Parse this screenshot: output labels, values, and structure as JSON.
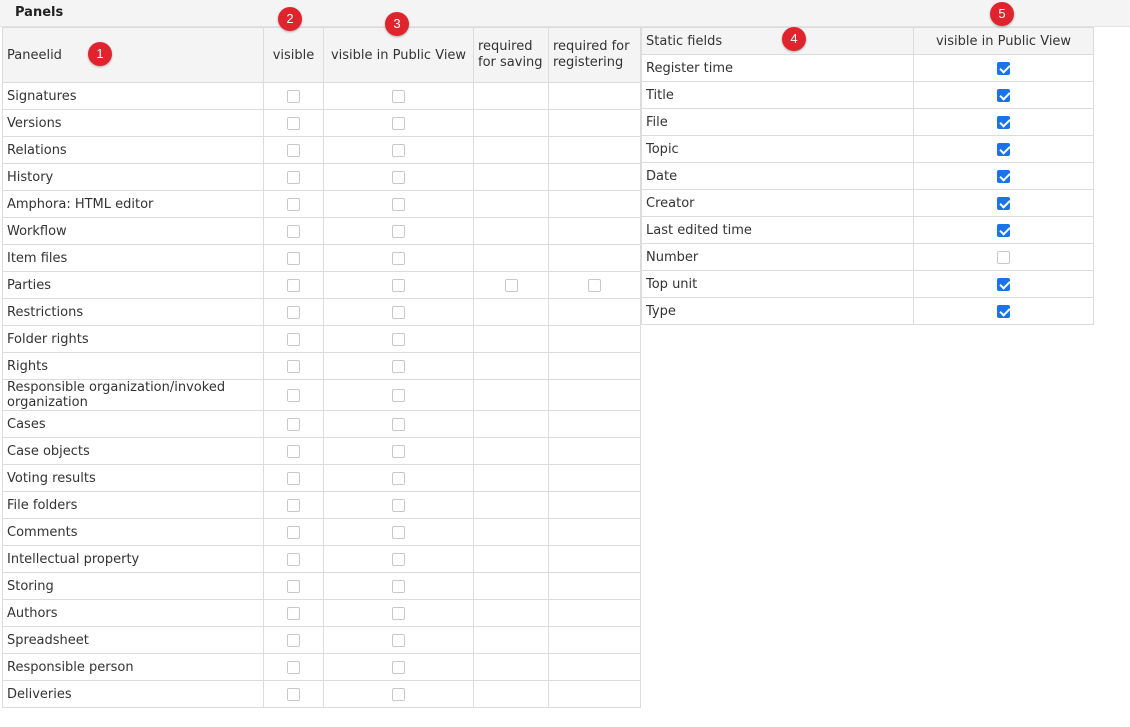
{
  "header": {
    "title": "Panels"
  },
  "panels_table": {
    "columns": [
      "Paneelid",
      "visible",
      "visible in Public View",
      "required for saving",
      "required for registering"
    ],
    "rows": [
      {
        "name": "Signatures",
        "visible": false,
        "public": false
      },
      {
        "name": "Versions",
        "visible": false,
        "public": false
      },
      {
        "name": "Relations",
        "visible": false,
        "public": false
      },
      {
        "name": "History",
        "visible": false,
        "public": false
      },
      {
        "name": "Amphora: HTML editor",
        "visible": false,
        "public": false
      },
      {
        "name": "Workflow",
        "visible": false,
        "public": false
      },
      {
        "name": "Item files",
        "visible": false,
        "public": false
      },
      {
        "name": "Parties",
        "visible": false,
        "public": false,
        "required_saving": false,
        "required_registering": false
      },
      {
        "name": "Restrictions",
        "visible": false,
        "public": false
      },
      {
        "name": "Folder rights",
        "visible": false,
        "public": false
      },
      {
        "name": "Rights",
        "visible": false,
        "public": false
      },
      {
        "name": "Responsible organization/invoked organization",
        "visible": false,
        "public": false
      },
      {
        "name": "Cases",
        "visible": false,
        "public": false
      },
      {
        "name": "Case objects",
        "visible": false,
        "public": false
      },
      {
        "name": "Voting results",
        "visible": false,
        "public": false
      },
      {
        "name": "File folders",
        "visible": false,
        "public": false
      },
      {
        "name": "Comments",
        "visible": false,
        "public": false
      },
      {
        "name": "Intellectual property",
        "visible": false,
        "public": false
      },
      {
        "name": "Storing",
        "visible": false,
        "public": false
      },
      {
        "name": "Authors",
        "visible": false,
        "public": false
      },
      {
        "name": "Spreadsheet",
        "visible": false,
        "public": false
      },
      {
        "name": "Responsible person",
        "visible": false,
        "public": false
      },
      {
        "name": "Deliveries",
        "visible": false,
        "public": false
      }
    ]
  },
  "static_table": {
    "columns": [
      "Static fields",
      "visible in Public View"
    ],
    "rows": [
      {
        "name": "Register time",
        "public": true
      },
      {
        "name": "Title",
        "public": true
      },
      {
        "name": "File",
        "public": true
      },
      {
        "name": "Topic",
        "public": true
      },
      {
        "name": "Date",
        "public": true
      },
      {
        "name": "Creator",
        "public": true
      },
      {
        "name": "Last edited time",
        "public": true
      },
      {
        "name": "Number",
        "public": false
      },
      {
        "name": "Top unit",
        "public": true
      },
      {
        "name": "Type",
        "public": true
      }
    ]
  },
  "markers": [
    "1",
    "2",
    "3",
    "4",
    "5"
  ],
  "colors": {
    "checkbox_checked": "#1a73e8",
    "marker": "#e0242d",
    "header_bg": "#f4f4f4",
    "border": "#dcdcdc"
  }
}
